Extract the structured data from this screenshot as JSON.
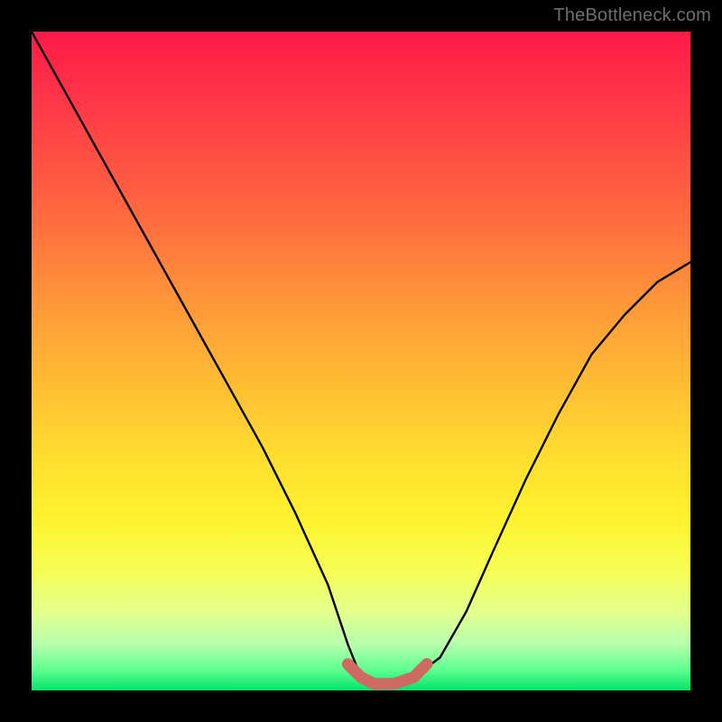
{
  "attribution": "TheBottleneck.com",
  "chart_data": {
    "type": "line",
    "title": "",
    "xlabel": "",
    "ylabel": "",
    "xlim": [
      0,
      100
    ],
    "ylim": [
      0,
      100
    ],
    "grid": false,
    "legend": false,
    "series": [
      {
        "name": "curve",
        "x": [
          0,
          5,
          10,
          15,
          20,
          25,
          30,
          35,
          40,
          45,
          48,
          50,
          52,
          55,
          58,
          62,
          66,
          70,
          75,
          80,
          85,
          90,
          95,
          100
        ],
        "y": [
          100,
          91,
          82,
          73,
          64,
          55,
          46,
          37,
          27,
          16,
          7,
          2,
          1,
          1,
          2,
          5,
          12,
          21,
          32,
          42,
          51,
          57,
          62,
          65
        ]
      }
    ],
    "trough_segment": {
      "x": [
        48,
        50,
        52,
        55,
        58,
        60
      ],
      "y": [
        4,
        2,
        1,
        1,
        2,
        4
      ]
    },
    "colors": {
      "curve": "#000000",
      "trough": "#cf6a62",
      "gradient_top": "#ff1947",
      "gradient_bottom": "#00e46a",
      "frame": "#000000"
    }
  }
}
